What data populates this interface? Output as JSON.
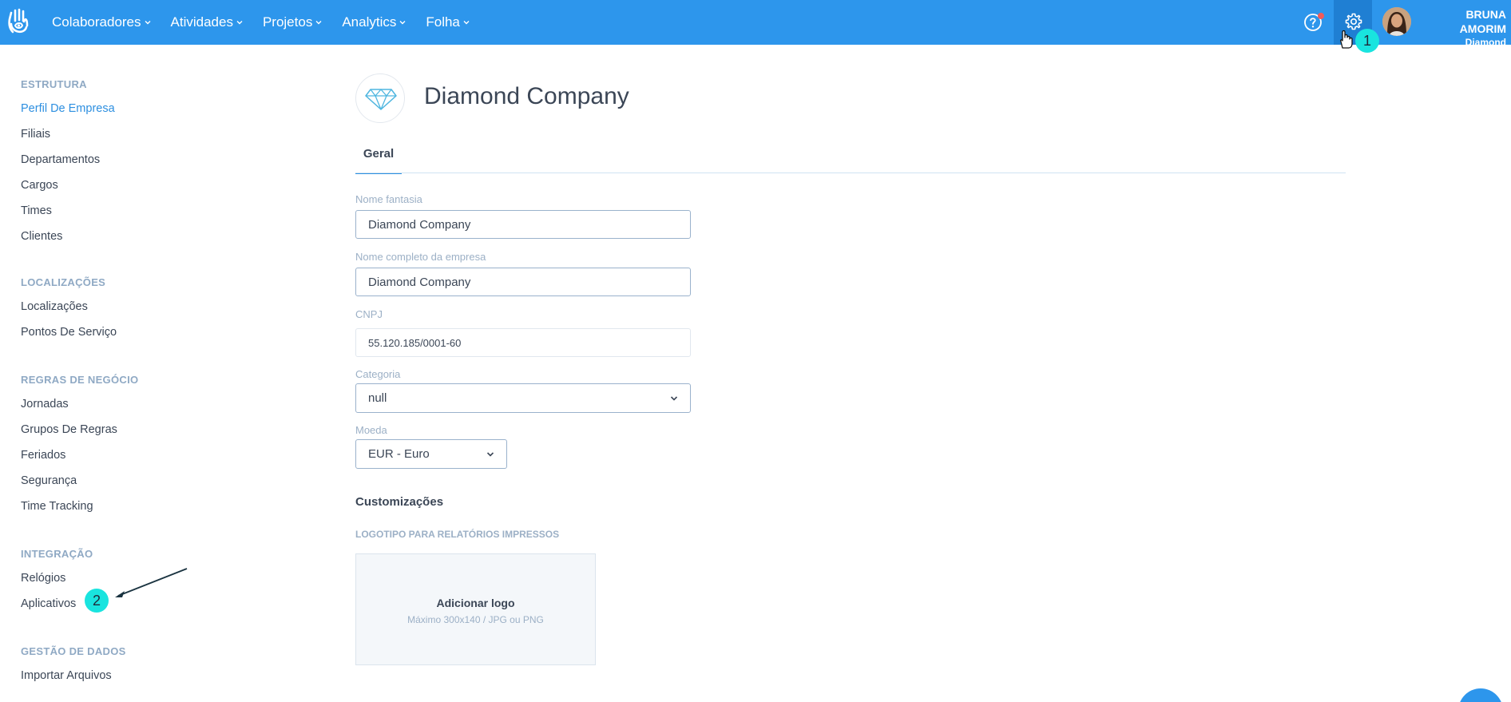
{
  "nav": {
    "items": [
      {
        "label": "Colaboradores"
      },
      {
        "label": "Atividades"
      },
      {
        "label": "Projetos"
      },
      {
        "label": "Analytics"
      },
      {
        "label": "Folha"
      }
    ]
  },
  "user": {
    "name": "BRUNA AMORIM",
    "company": "Diamond Company"
  },
  "annotations": {
    "badge1": "1",
    "badge2": "2"
  },
  "sidebar": {
    "sections": [
      {
        "title": "ESTRUTURA",
        "items": [
          "Perfil De Empresa",
          "Filiais",
          "Departamentos",
          "Cargos",
          "Times",
          "Clientes"
        ]
      },
      {
        "title": "LOCALIZAÇÕES",
        "items": [
          "Localizações",
          "Pontos De Serviço"
        ]
      },
      {
        "title": "REGRAS DE NEGÓCIO",
        "items": [
          "Jornadas",
          "Grupos De Regras",
          "Feriados",
          "Segurança",
          "Time Tracking"
        ]
      },
      {
        "title": "INTEGRAÇÃO",
        "items": [
          "Relógios",
          "Aplicativos"
        ]
      },
      {
        "title": "GESTÃO DE DADOS",
        "items": [
          "Importar Arquivos"
        ]
      }
    ]
  },
  "main": {
    "title": "Diamond Company",
    "tab": "Geral",
    "fields": {
      "nome_fantasia": {
        "label": "Nome fantasia",
        "value": "Diamond Company"
      },
      "nome_completo": {
        "label": "Nome completo da empresa",
        "value": "Diamond Company"
      },
      "cnpj": {
        "label": "CNPJ",
        "value": "55.120.185/0001-60"
      },
      "categoria": {
        "label": "Categoria",
        "value": "null"
      },
      "moeda": {
        "label": "Moeda",
        "value": "EUR - Euro"
      }
    },
    "customizacoes": "Customizações",
    "logo_label": "LOGOTIPO PARA RELATÓRIOS IMPRESSOS",
    "upload_title": "Adicionar logo",
    "upload_hint": "Máximo 300x140 / JPG ou PNG"
  },
  "colors": {
    "topbar": "#2d96ec",
    "active_link": "#2d8fe0",
    "badge": "#19e4df"
  }
}
